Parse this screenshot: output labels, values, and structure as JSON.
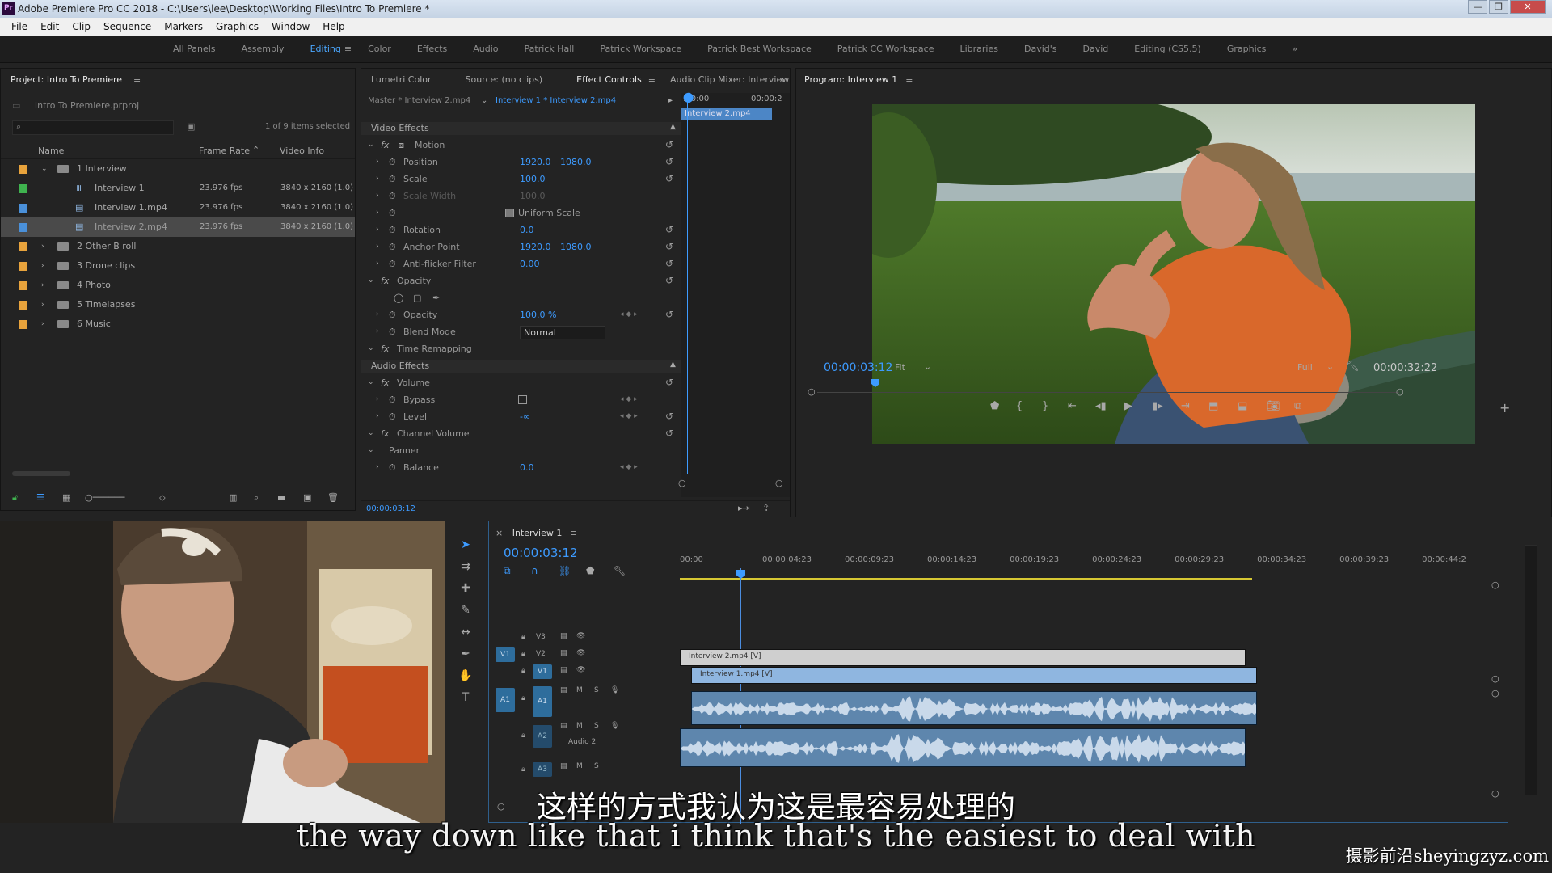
{
  "window": {
    "title": "Adobe Premiere Pro CC 2018 - C:\\Users\\lee\\Desktop\\Working Files\\Intro To Premiere *",
    "app_icon": "Pr",
    "controls": [
      "—",
      "❐",
      "✕"
    ]
  },
  "menu": [
    "File",
    "Edit",
    "Clip",
    "Sequence",
    "Markers",
    "Graphics",
    "Window",
    "Help"
  ],
  "workspaces": {
    "items": [
      "All Panels",
      "Assembly",
      "Editing",
      "Color",
      "Effects",
      "Audio",
      "Patrick Hall",
      "Patrick Workspace",
      "Patrick Best Workspace",
      "Patrick CC Workspace",
      "Libraries",
      "David's",
      "David",
      "Editing (CS5.5)",
      "Graphics"
    ],
    "active": "Editing",
    "overflow": "»"
  },
  "project": {
    "title": "Project: Intro To Premiere",
    "file": "Intro To Premiere.prproj",
    "selection": "1 of 9 items selected",
    "columns": [
      "Name",
      "Frame Rate",
      "Video Info"
    ],
    "items": [
      {
        "name": "1 Interview",
        "rate": "",
        "info": "",
        "color": "#e8a33c",
        "kind": "folder",
        "indent": 0,
        "expanded": true
      },
      {
        "name": "Interview 1",
        "rate": "23.976 fps",
        "info": "3840 x 2160 (1.0)",
        "color": "#3fb34f",
        "kind": "sequence",
        "indent": 1
      },
      {
        "name": "Interview 1.mp4",
        "rate": "23.976 fps",
        "info": "3840 x 2160 (1.0)",
        "color": "#4a90d9",
        "kind": "clip",
        "indent": 1
      },
      {
        "name": "Interview 2.mp4",
        "rate": "23.976 fps",
        "info": "3840 x 2160 (1.0)",
        "color": "#4a90d9",
        "kind": "clip",
        "indent": 1,
        "selected": true
      },
      {
        "name": "2 Other B roll",
        "rate": "",
        "info": "",
        "color": "#e8a33c",
        "kind": "folder",
        "indent": 0
      },
      {
        "name": "3 Drone clips",
        "rate": "",
        "info": "",
        "color": "#e8a33c",
        "kind": "folder",
        "indent": 0
      },
      {
        "name": "4 Photo",
        "rate": "",
        "info": "",
        "color": "#e8a33c",
        "kind": "folder",
        "indent": 0
      },
      {
        "name": "5 Timelapses",
        "rate": "",
        "info": "",
        "color": "#e8a33c",
        "kind": "folder",
        "indent": 0
      },
      {
        "name": "6 Music",
        "rate": "",
        "info": "",
        "color": "#e8a33c",
        "kind": "folder",
        "indent": 0
      }
    ]
  },
  "source_tabs": [
    "Lumetri Color",
    "Source: (no clips)",
    "Effect Controls",
    "Audio Clip Mixer: Interview"
  ],
  "source_active": "Effect Controls",
  "effect_controls": {
    "master": "Master * Interview 2.mp4",
    "sequence_clip": "Interview 1 * Interview 2.mp4",
    "mini_timecodes": [
      ":00:00",
      "00:00:2"
    ],
    "mini_clip": "Interview 2.mp4",
    "video_section": "Video Effects",
    "audio_section": "Audio Effects",
    "rows": [
      {
        "label": "Motion",
        "level": 0,
        "fx": true
      },
      {
        "label": "Position",
        "v1": "1920.0",
        "v2": "1080.0",
        "level": 1
      },
      {
        "label": "Scale",
        "v1": "100.0",
        "level": 1
      },
      {
        "label": "Scale Width",
        "v1": "100.0",
        "level": 1,
        "disabled": true
      },
      {
        "label": "Uniform Scale",
        "level": 1,
        "checkbox": true
      },
      {
        "label": "Rotation",
        "v1": "0.0",
        "level": 1
      },
      {
        "label": "Anchor Point",
        "v1": "1920.0",
        "v2": "1080.0",
        "level": 1
      },
      {
        "label": "Anti-flicker Filter",
        "v1": "0.00",
        "level": 1
      },
      {
        "label": "Opacity",
        "level": 0,
        "fx": true
      },
      {
        "label": "Opacity",
        "v1": "100.0 %",
        "level": 1
      },
      {
        "label": "Blend Mode",
        "v1": "Normal",
        "level": 1,
        "dropdown": true
      },
      {
        "label": "Time Remapping",
        "level": 0,
        "fx": true
      },
      {
        "label": "Volume",
        "level": 0,
        "fx": true
      },
      {
        "label": "Bypass",
        "level": 1,
        "checkbox": true
      },
      {
        "label": "Level",
        "v1": "-∞",
        "level": 1
      },
      {
        "label": "Channel Volume",
        "level": 0,
        "fx": true
      },
      {
        "label": "Panner",
        "level": 0
      },
      {
        "label": "Balance",
        "v1": "0.0",
        "level": 1
      }
    ],
    "footer_timecode": "00:00:03:12"
  },
  "program": {
    "title": "Program: Interview 1",
    "timecode": "00:00:03:12",
    "fit": "Fit",
    "quality": "Full",
    "duration": "00:00:32:22",
    "playhead_fraction": 0.1
  },
  "timeline": {
    "tab": "Interview 1",
    "timecode": "00:00:03:12",
    "ruler": [
      "00:00",
      "00:00:04:23",
      "00:00:09:23",
      "00:00:14:23",
      "00:00:19:23",
      "00:00:24:23",
      "00:00:29:23",
      "00:00:34:23",
      "00:00:39:23",
      "00:00:44:2"
    ],
    "tracks": {
      "video": [
        "V3",
        "V2",
        "V1"
      ],
      "audio": [
        "A1",
        "A2",
        "A3"
      ],
      "source_patch_v": "V1",
      "source_patch_a": "A1",
      "audio2_name": "Audio 2"
    },
    "clips": [
      {
        "track": "V2",
        "label": "Interview 2.mp4 [V]"
      },
      {
        "track": "V1",
        "label": "Interview 1.mp4 [V]"
      }
    ],
    "track_buttons": [
      "M",
      "S"
    ]
  },
  "subtitles": {
    "cn": "这样的方式我认为这是最容易处理的",
    "en": "the way down like that i think that's the easiest to deal with"
  },
  "watermark": "摄影前沿sheyingzyz.com",
  "icons": {
    "tools": [
      "selection-tool-icon",
      "track-select-icon",
      "ripple-edit-icon",
      "razor-icon",
      "slip-icon",
      "pen-icon",
      "hand-icon",
      "type-icon"
    ]
  },
  "colors": {
    "accent_blue": "#3d9bff",
    "clip_video_v2": "#cfcfcf",
    "clip_video_v1": "#8fb6e0",
    "clip_audio": "#5e86ad",
    "folder_label": "#e8a33c"
  }
}
